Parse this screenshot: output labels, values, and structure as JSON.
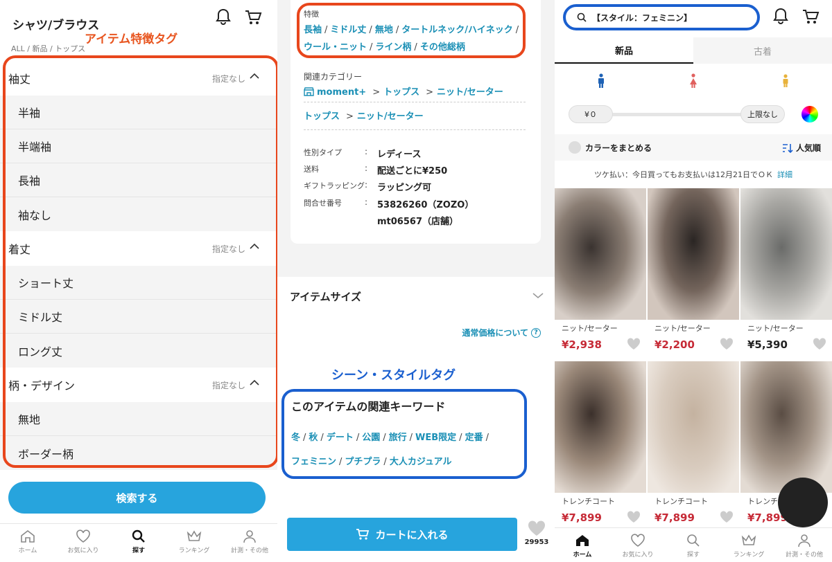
{
  "panel1": {
    "title": "シャツ/ブラウス",
    "breadcrumb": "ALL / 新品 / トップス",
    "annotation": "アイテム特徴タグ",
    "none_label": "指定なし",
    "sections": [
      {
        "label": "袖丈",
        "options": [
          "半袖",
          "半端袖",
          "長袖",
          "袖なし"
        ]
      },
      {
        "label": "着丈",
        "options": [
          "ショート丈",
          "ミドル丈",
          "ロング丈"
        ]
      },
      {
        "label": "柄・デザイン",
        "options": [
          "無地",
          "ボーダー柄"
        ]
      }
    ],
    "search_button": "検索する",
    "tabs": [
      "ホーム",
      "お気に入り",
      "探す",
      "ランキング",
      "計測・その他"
    ]
  },
  "panel2": {
    "features_label": "特徴",
    "features_line1": [
      "長袖",
      "ミドル丈",
      "無地",
      "タートルネック/ハイネック"
    ],
    "features_line2": [
      "ウール・ニット",
      "ライン柄",
      "その他総柄"
    ],
    "related_label": "関連カテゴリー",
    "related_1": [
      "moment+",
      "トップス",
      "ニット/セーター"
    ],
    "related_2": [
      "トップス",
      "ニット/セーター"
    ],
    "info": [
      {
        "k": "性別タイプ",
        "v": "レディース"
      },
      {
        "k": "送料",
        "v": "配送ごとに¥250"
      },
      {
        "k": "ギフトラッピング",
        "v": "ラッピング可"
      },
      {
        "k": "問合せ番号",
        "v": "53826260（ZOZO）"
      },
      {
        "k": "",
        "v": "mt06567（店舗）"
      }
    ],
    "item_size": "アイテムサイズ",
    "price_note": "通常価格について",
    "annotation": "シーン・スタイルタグ",
    "keywords_title": "このアイテムの関連キーワード",
    "keywords_line1": [
      "冬",
      "秋",
      "デート",
      "公園",
      "旅行",
      "WEB限定",
      "定番"
    ],
    "keywords_line2": [
      "フェミニン",
      "プチプラ",
      "大人カジュアル"
    ],
    "cart_button": "カートに入れる",
    "fav_count": "29953"
  },
  "panel3": {
    "search_text": "【スタイル：フェミニン】",
    "tabs": [
      "新品",
      "古着"
    ],
    "price_min": "¥０",
    "price_max": "上限なし",
    "color_group": "カラーをまとめる",
    "sort": "人気順",
    "notice": "ツケ払い：今日買ってもお支払いは12月21日でＯＫ",
    "notice_link": "詳細",
    "products": [
      {
        "cat": "ニット/セーター",
        "price": "¥2,938"
      },
      {
        "cat": "ニット/セーター",
        "price": "¥2,200"
      },
      {
        "cat": "ニット/セーター",
        "price": "¥5,390"
      },
      {
        "cat": "トレンチコート",
        "price": "¥7,899"
      },
      {
        "cat": "トレンチコート",
        "price": "¥7,899"
      },
      {
        "cat": "トレンチコート",
        "price": "¥7,899"
      }
    ],
    "tabs_bottom": [
      "ホーム",
      "お気に入り",
      "探す",
      "ランキング",
      "計測・その他"
    ]
  },
  "colors": {
    "accent": "#27a4dd",
    "link": "#1a8fb5",
    "price": "#c62a36",
    "annotation_orange": "#e8461c",
    "annotation_blue": "#1a5fcf"
  }
}
